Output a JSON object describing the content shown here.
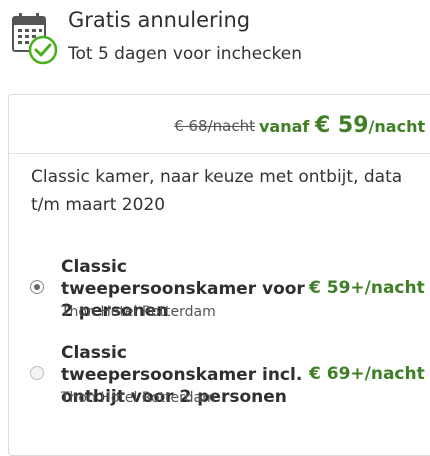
{
  "cancellation": {
    "title": "Gratis annulering",
    "subtitle": "Tot 5 dagen voor inchecken"
  },
  "offer": {
    "old_price": "€ 68/nacht",
    "from_label": "vanaf",
    "price_amount": "€ 59",
    "price_unit": "/nacht",
    "description": "Classic kamer, naar keuze met ontbijt, data t/m maart 2020"
  },
  "options": [
    {
      "name": "Classic tweepersoonskamer voor 2 personen",
      "hotel": "Thon Hotel Rotterdam",
      "price": "€ 59+/nacht",
      "selected": true
    },
    {
      "name": "Classic tweepersoonskamer incl. ontbijt voor 2 personen",
      "hotel": "Thon Hotel Rotterdam",
      "price": "€ 69+/nacht",
      "selected": false
    }
  ],
  "colors": {
    "price_green": "#3f7f26",
    "icon_green": "#4caf1f",
    "border": "#dcdcdc"
  },
  "icons": {
    "cancellation": "calendar-check-icon"
  }
}
